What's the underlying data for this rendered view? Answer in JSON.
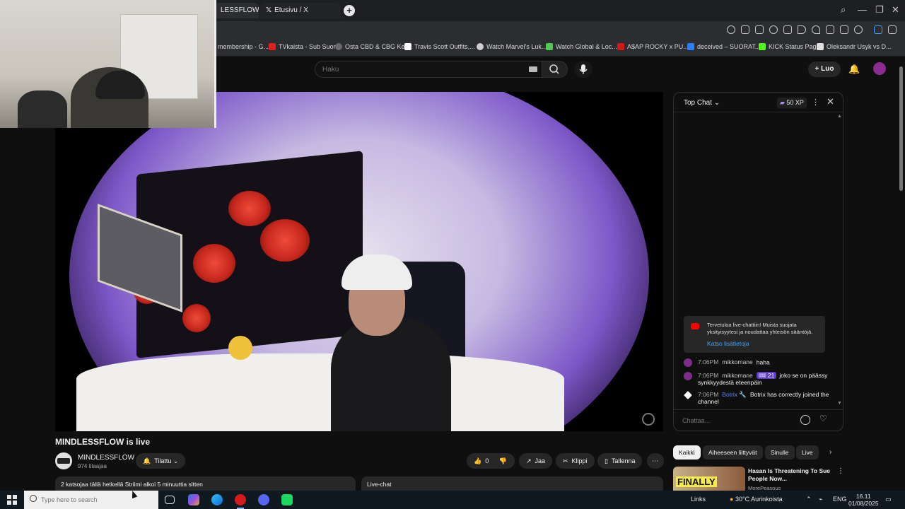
{
  "browser": {
    "tabs": [
      {
        "label": "LESSFLOW is live",
        "active": true
      },
      {
        "label": "Etusivu / X",
        "icon": "x-logo",
        "active": false
      }
    ],
    "new_tab": "+",
    "bookmarks": [
      {
        "label": "membership - G...",
        "color": "#8a8a8a"
      },
      {
        "label": "TVkaista - Sub Suora",
        "color": "#e02020"
      },
      {
        "label": "Osta CBD & CBG Ke...",
        "color": "#6a6a6a"
      },
      {
        "label": "Travis Scott Outfits,...",
        "color": "#ffffff"
      },
      {
        "label": "Watch Marvel's Luk...",
        "color": "#cfcfcf"
      },
      {
        "label": "Watch Global & Loc...",
        "color": "#53c653"
      },
      {
        "label": "A$AP ROCKY x PU...",
        "color": "#d01818"
      },
      {
        "label": "deceived – SUORAT...",
        "color": "#2f7df6"
      },
      {
        "label": "KICK Status Page",
        "color": "#53fc18"
      },
      {
        "label": "Oleksandr Usyk vs D...",
        "color": "#e0e0e0"
      }
    ]
  },
  "youtube": {
    "search_placeholder": "Haku",
    "create_label": "Luo",
    "video": {
      "title": "MINDLESSFLOW is live",
      "channel": "MINDLESSFLOW",
      "subscribers": "974 tilaajaa",
      "subscribe_label": "Tilattu",
      "like_count": "0",
      "share_label": "Jaa",
      "clip_label": "Klippi",
      "save_label": "Tallenna",
      "description": "2 katsojaa tällä hetkellä  Striimi alkoi 5 minuuttia sitten",
      "live_chat_label": "Live-chat"
    },
    "chat": {
      "title": "Top Chat",
      "xp": "50 XP",
      "notice": "Tervetuloa live-chattiin! Muista suojata yksityisyytesi ja noudattaa yhteisön sääntöjä.",
      "notice_link": "Katso lisätietoja",
      "messages": [
        {
          "time": "7:06PM",
          "author": "mikkomane",
          "badge": "",
          "text": "haha"
        },
        {
          "time": "7:06PM",
          "author": "mikkomane",
          "badge": "🎟 21",
          "text": "joko se on päässy synkkyydestä eteenpäin"
        },
        {
          "time": "7:06PM",
          "author": "Botrix 🔧",
          "badge": "",
          "text": "Botrix has correctly joined the channel"
        }
      ],
      "input_placeholder": "Chattaa..."
    },
    "related": {
      "chips": [
        "Kaikki",
        "Aiheeseen liittyvät",
        "Sinulle",
        "Live"
      ],
      "item": {
        "thumb_text": "FINALLY",
        "title": "Hasan Is Threatening To Sue People Now...",
        "channel": "MorePeasous"
      }
    }
  },
  "taskbar": {
    "search_placeholder": "Type here to search",
    "links_label": "Links",
    "weather": "30°C  Aurinkoista",
    "language": "ENG",
    "time": "16.11",
    "date": "01/08/2025"
  }
}
